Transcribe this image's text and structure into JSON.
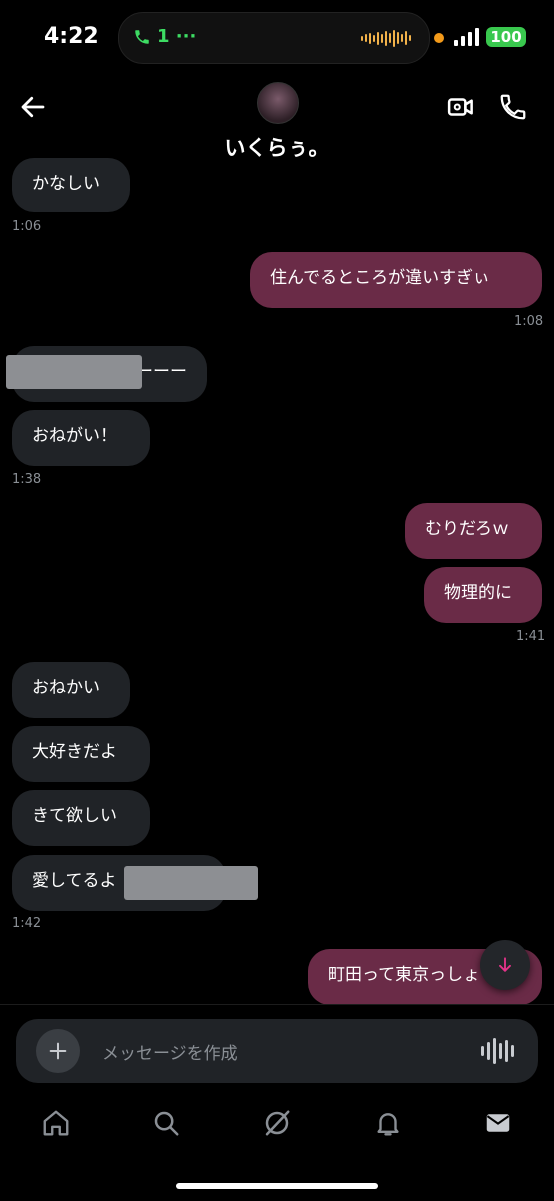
{
  "status": {
    "time": "4:22",
    "call_label": "1 ···",
    "battery": "100"
  },
  "header": {
    "contact_name": "いくらぅ。",
    "icons": [
      "back-arrow-icon",
      "video-call-icon",
      "phone-icon"
    ]
  },
  "messages": [
    {
      "dir": "in",
      "text": "かなしい"
    },
    {
      "time": "1:06"
    },
    {
      "dir": "out",
      "text": "住んでるところが違いすぎぃ"
    },
    {
      "time": "1:08"
    },
    {
      "dir": "in",
      "text": "ーーー",
      "redacted": true
    },
    {
      "dir": "in",
      "text": "おねがい！"
    },
    {
      "time": "1:38"
    },
    {
      "dir": "out",
      "text": "むりだろｗ"
    },
    {
      "dir": "out",
      "text": "物理的に"
    },
    {
      "time": "1:41"
    },
    {
      "dir": "in",
      "text": "おねかい"
    },
    {
      "dir": "in",
      "text": "大好きだよ"
    },
    {
      "dir": "in",
      "text": "きて欲しい"
    },
    {
      "dir": "in",
      "text": "愛してるよ",
      "redacted": true
    },
    {
      "time": "1:42"
    },
    {
      "dir": "out",
      "text": "町田って東京っしょ"
    }
  ],
  "composer": {
    "placeholder": "メッセージを作成",
    "icons": [
      "plus-icon",
      "voice-icon"
    ]
  },
  "tabbar": {
    "icons": [
      "home-icon",
      "search-icon",
      "grok-icon",
      "notifications-icon",
      "messages-icon"
    ]
  },
  "colors": {
    "accent": "#6a2b47",
    "incoming_bubble": "#202327",
    "background": "#000000",
    "scroll_arrow": "#e5338a"
  }
}
